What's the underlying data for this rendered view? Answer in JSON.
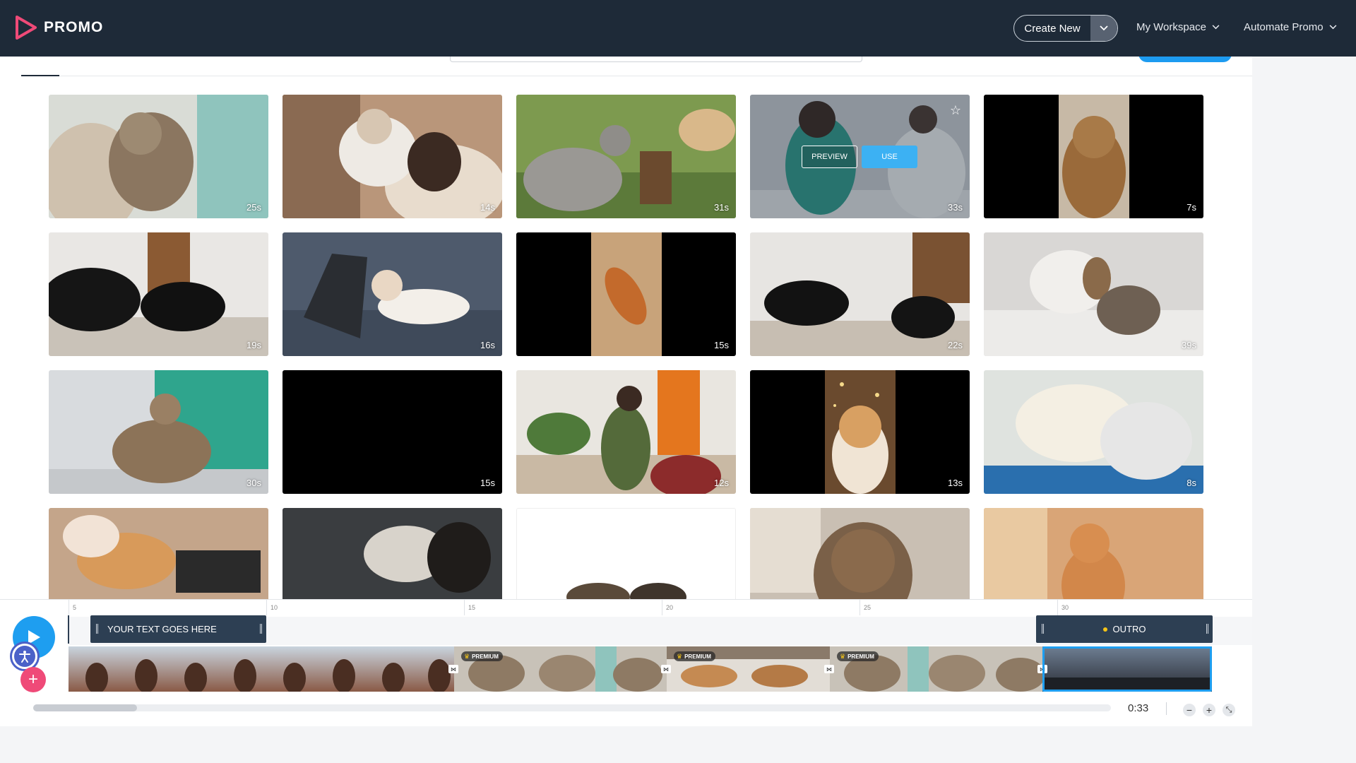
{
  "brand": {
    "name": "PROMO",
    "accent": "#ef4a78",
    "topbar_bg": "#1e2a38"
  },
  "nav": {
    "create_new": "Create New",
    "my_workspace": "My Workspace",
    "automate": "Automate Promo"
  },
  "tiles": [
    {
      "duration": "25s",
      "art": "vet-cat-cuddle"
    },
    {
      "duration": "14s",
      "art": "white-cat-on-shoulder"
    },
    {
      "duration": "31s",
      "art": "cats-in-grass"
    },
    {
      "duration": "33s",
      "art": "vet-clinic",
      "hover": true
    },
    {
      "duration": "7s",
      "art": "vertical-tabby"
    },
    {
      "duration": "19s",
      "art": "black-cat-porch"
    },
    {
      "duration": "16s",
      "art": "cat-laptop-sofa"
    },
    {
      "duration": "15s",
      "art": "ginger-cat-floor-vertical"
    },
    {
      "duration": "22s",
      "art": "two-black-cats-snow"
    },
    {
      "duration": "39s",
      "art": "puppy-kitten"
    },
    {
      "duration": "30s",
      "art": "vet-green-scrubs"
    },
    {
      "duration": "15s",
      "art": "black"
    },
    {
      "duration": "12s",
      "art": "woman-with-cat-chair"
    },
    {
      "duration": "13s",
      "art": "christmas-cat-vertical"
    },
    {
      "duration": "8s",
      "art": "fluffy-white-kittens"
    },
    {
      "duration": "",
      "art": "cat-on-desk-keyboard"
    },
    {
      "duration": "",
      "art": "fluffy-cat-dark"
    },
    {
      "duration": "",
      "art": "cats-on-white"
    },
    {
      "duration": "",
      "art": "tabby-closeup-outdoors"
    },
    {
      "duration": "",
      "art": "ginger-cat-indoors"
    }
  ],
  "hover_actions": {
    "preview": "PREVIEW",
    "use": "USE"
  },
  "timeline": {
    "ruler": [
      "5",
      "10",
      "15",
      "20",
      "25",
      "30"
    ],
    "text_clip": "YOUR TEXT GOES HERE",
    "outro": "OUTRO",
    "premium_badge": "PREMIUM",
    "time": "0:33"
  },
  "icons": [
    "play-icon",
    "accessibility-icon",
    "plus-icon",
    "minus-icon",
    "zoom-plus-icon",
    "collapse-icon",
    "star-icon",
    "chevron-down-icon"
  ]
}
